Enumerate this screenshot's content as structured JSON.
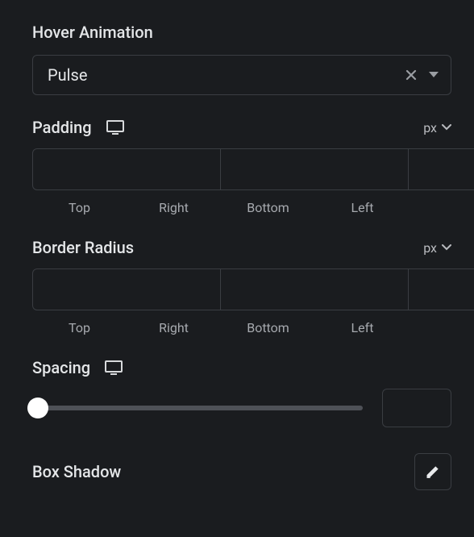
{
  "hover_animation": {
    "title": "Hover Animation",
    "value": "Pulse"
  },
  "padding": {
    "title": "Padding",
    "unit": "px",
    "top": "",
    "right": "",
    "bottom": "",
    "left": "",
    "labels": {
      "top": "Top",
      "right": "Right",
      "bottom": "Bottom",
      "left": "Left"
    }
  },
  "border_radius": {
    "title": "Border Radius",
    "unit": "px",
    "top": "",
    "right": "",
    "bottom": "",
    "left": "",
    "labels": {
      "top": "Top",
      "right": "Right",
      "bottom": "Bottom",
      "left": "Left"
    }
  },
  "spacing": {
    "title": "Spacing",
    "value": ""
  },
  "box_shadow": {
    "title": "Box Shadow"
  }
}
